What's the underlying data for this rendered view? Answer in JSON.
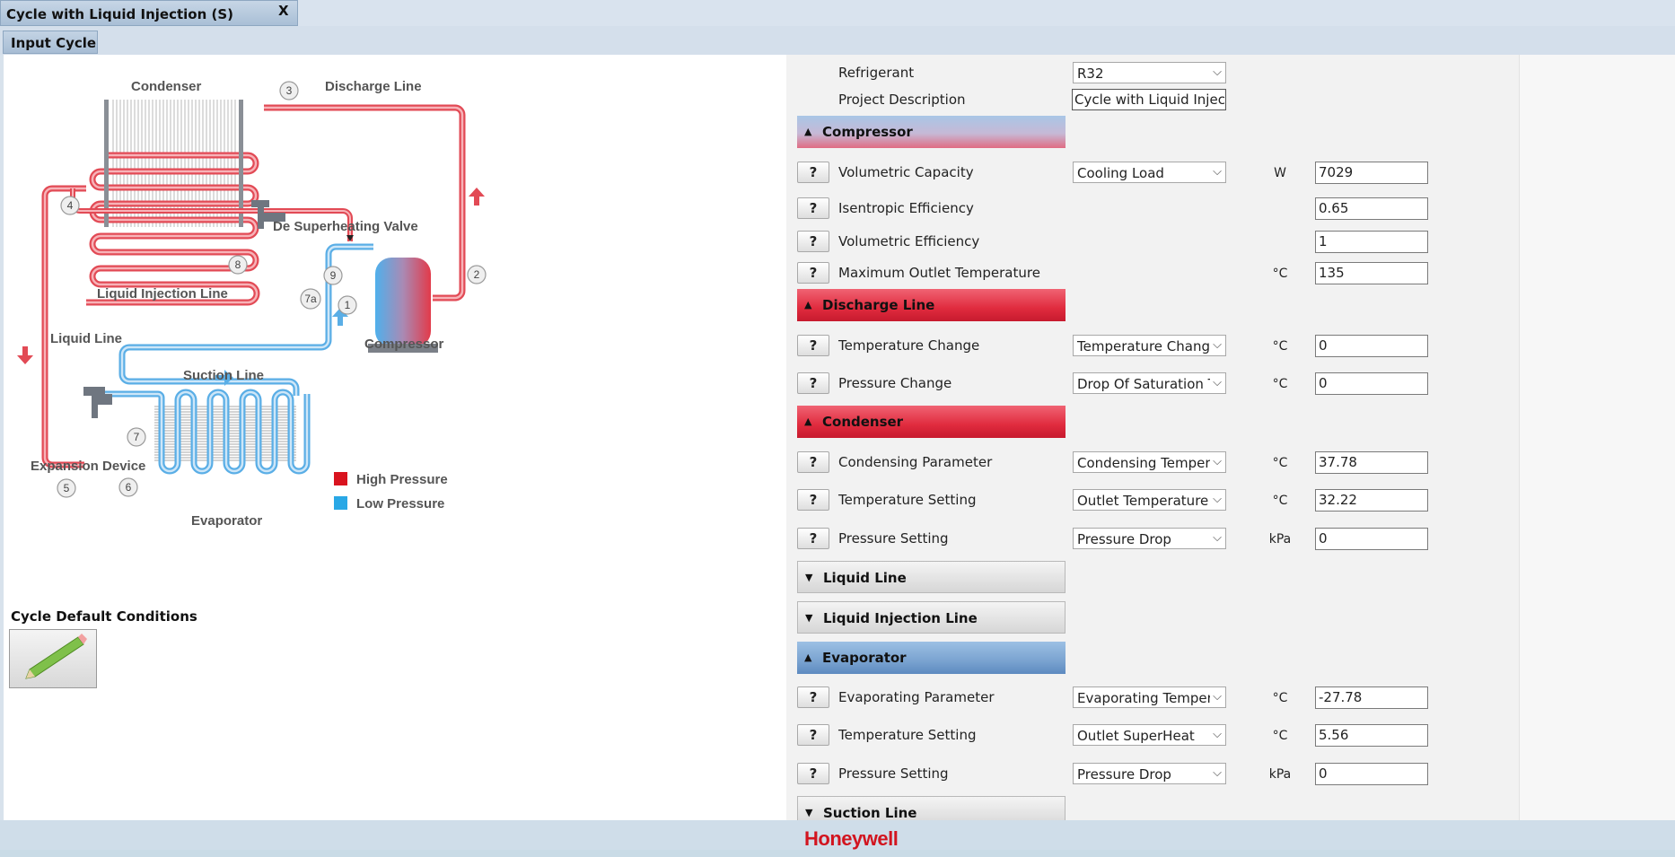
{
  "window": {
    "tab_title": "Cycle with Liquid Injection (S)",
    "close_glyph": "X"
  },
  "subtab": {
    "label": "Input Cycle"
  },
  "diagram": {
    "labels": {
      "condenser": "Condenser",
      "discharge_line": "Discharge Line",
      "de_superheating_valve": "De Superheating Valve",
      "liquid_injection_line": "Liquid Injection Line",
      "liquid_line": "Liquid Line",
      "compressor": "Compressor",
      "suction_line": "Suction Line",
      "expansion_device": "Expansion Device",
      "evaporator": "Evaporator"
    },
    "points": {
      "p1": "1",
      "p2": "2",
      "p3": "3",
      "p4": "4",
      "p5": "5",
      "p6": "6",
      "p7": "7",
      "p7a": "7a",
      "p8": "8",
      "p9": "9"
    },
    "legend": {
      "high": "High Pressure",
      "low": "Low Pressure",
      "high_color": "#d9141f",
      "low_color": "#29a8e6"
    },
    "pipe_colors": {
      "high": "#e24a55",
      "low": "#5aaee6"
    }
  },
  "cycle_defaults": {
    "label": "Cycle Default Conditions",
    "icon": "pencil-icon"
  },
  "form": {
    "refrigerant": {
      "label": "Refrigerant",
      "value": "R32"
    },
    "project": {
      "label": "Project Description",
      "value": "Cycle with Liquid Inject"
    },
    "help_label": "?",
    "compressor": {
      "title": "Compressor",
      "volumetric_capacity": {
        "label": "Volumetric Capacity",
        "select": "Cooling Load",
        "unit": "W",
        "value": "7029"
      },
      "isentropic_efficiency": {
        "label": "Isentropic Efficiency",
        "value": "0.65"
      },
      "volumetric_efficiency": {
        "label": "Volumetric Efficiency",
        "value": "1"
      },
      "max_outlet_temp": {
        "label": "Maximum Outlet Temperature",
        "unit": "°C",
        "value": "135"
      }
    },
    "discharge_line": {
      "title": "Discharge Line",
      "temperature_change": {
        "label": "Temperature Change",
        "select": "Temperature Chang",
        "unit": "°C",
        "value": "0"
      },
      "pressure_change": {
        "label": "Pressure Change",
        "select": "Drop Of Saturation T",
        "unit": "°C",
        "value": "0"
      }
    },
    "condenser": {
      "title": "Condenser",
      "condensing_parameter": {
        "label": "Condensing Parameter",
        "select": "Condensing Temper",
        "unit": "°C",
        "value": "37.78"
      },
      "temperature_setting": {
        "label": "Temperature Setting",
        "select": "Outlet Temperature",
        "unit": "°C",
        "value": "32.22"
      },
      "pressure_setting": {
        "label": "Pressure Setting",
        "select": "Pressure Drop",
        "unit": "kPa",
        "value": "0"
      }
    },
    "liquid_line": {
      "title": "Liquid Line"
    },
    "liquid_injection_line": {
      "title": "Liquid Injection Line"
    },
    "evaporator": {
      "title": "Evaporator",
      "evaporating_parameter": {
        "label": "Evaporating Parameter",
        "select": "Evaporating Temper",
        "unit": "°C",
        "value": "-27.78"
      },
      "temperature_setting": {
        "label": "Temperature Setting",
        "select": "Outlet SuperHeat",
        "unit": "°C",
        "value": "5.56"
      },
      "pressure_setting": {
        "label": "Pressure Setting",
        "select": "Pressure Drop",
        "unit": "kPa",
        "value": "0"
      }
    },
    "suction_line": {
      "title": "Suction Line"
    },
    "glyphs": {
      "expanded": "▲",
      "collapsed": "▼",
      "dropdown": "⌵"
    }
  },
  "footer": {
    "brand": "Honeywell"
  }
}
